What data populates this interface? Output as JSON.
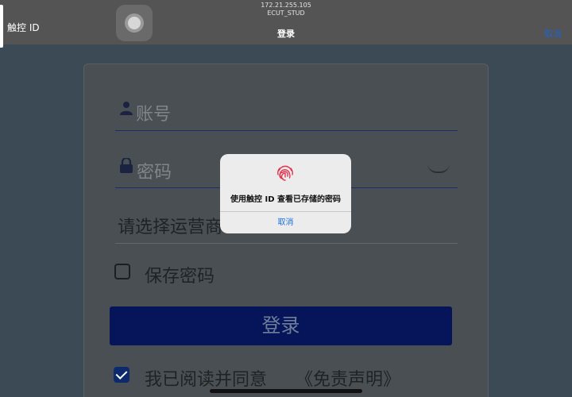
{
  "status": {
    "touchid_label": "触控 ID",
    "ip_address": "172.21.255.105",
    "ssid": "ECUT_STUD"
  },
  "nav": {
    "title": "登录",
    "cancel_label": "取消"
  },
  "form": {
    "account_placeholder": "账号",
    "password_placeholder": "密码",
    "carrier_select": "请选择运营商",
    "save_password_label": "保存密码",
    "save_password_checked": false,
    "login_button": "登录",
    "agree_label": "我已阅读并同意",
    "agree_checked": true,
    "disclaimer_link": "《免责声明》"
  },
  "alert": {
    "message": "使用触控 ID 查看已存储的密码",
    "cancel_label": "取消"
  },
  "colors": {
    "topbar": "#545454",
    "background": "#3b4a55",
    "login_button": "#06145a",
    "link_blue": "#1a6fe0",
    "fingerprint": "#e0354f"
  }
}
